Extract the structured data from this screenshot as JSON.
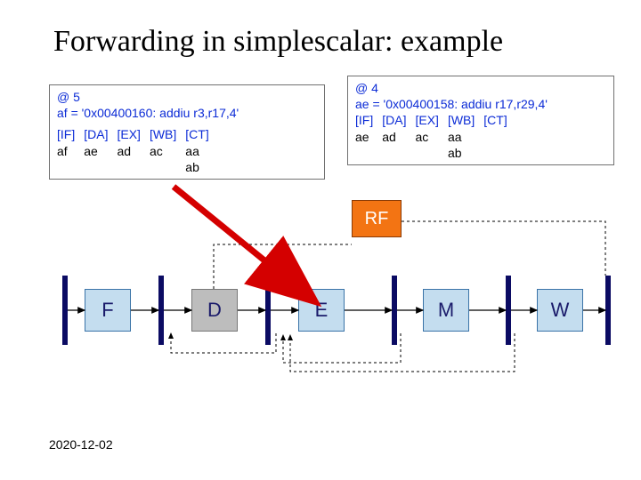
{
  "title": "Forwarding in simplescalar: example",
  "footer_date": "2020-12-02",
  "panel_left": {
    "cycle": "@ 5",
    "instr": "af = '0x00400160: addiu   r3,r17,4'",
    "cols": [
      "[IF]",
      "[DA]",
      "[EX]",
      "[WB]",
      "[CT]"
    ],
    "vals": [
      "af",
      "ae",
      "ad",
      "ac",
      "aa"
    ],
    "extra": "ab"
  },
  "panel_right": {
    "cycle": "@ 4",
    "instr": "ae = '0x00400158: addiu   r17,r29,4'",
    "cols": [
      "[IF]",
      "[DA]",
      "[EX]",
      "[WB]",
      "[CT]"
    ],
    "vals": [
      "ae",
      "ad",
      "ac",
      "aa",
      ""
    ],
    "extra": "ab"
  },
  "rf_label": "RF",
  "stages": {
    "f": "F",
    "d": "D",
    "e": "E",
    "m": "M",
    "w": "W"
  }
}
